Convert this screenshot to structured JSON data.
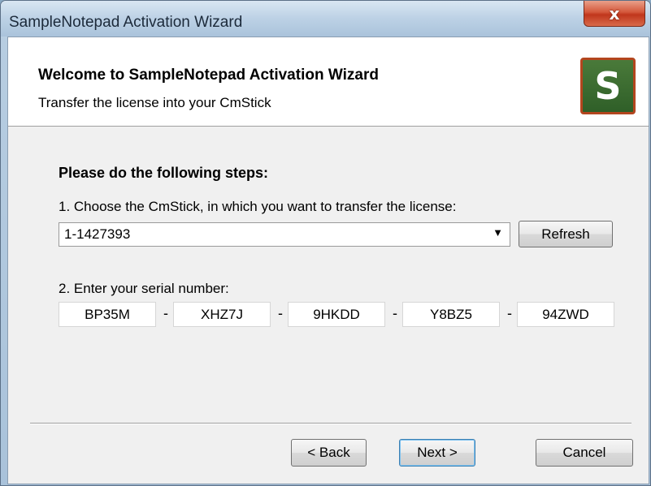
{
  "window": {
    "title": "SampleNotepad Activation Wizard",
    "close_label": "x"
  },
  "header": {
    "title": "Welcome to SampleNotepad Activation Wizard",
    "subtitle": "Transfer the license into your CmStick",
    "logo_letter": "S"
  },
  "steps": {
    "heading": "Please do the following steps:",
    "step1_label": "1. Choose the CmStick, in which you want to transfer the license:",
    "cmstick_selected": "1-1427393",
    "refresh_label": "Refresh",
    "step2_label": "2. Enter your serial number:",
    "serial_parts": [
      "BP35M",
      "XHZ7J",
      "9HKDD",
      "Y8BZ5",
      "94ZWD"
    ],
    "separator_char": "-"
  },
  "footer": {
    "back_label": "< Back",
    "next_label": "Next >",
    "cancel_label": "Cancel"
  },
  "colors": {
    "titlebar": "#bcd1e5",
    "close": "#c0361c",
    "client_bg": "#f0f0f0",
    "logo_bg": "#2f5f28",
    "logo_border": "#b3461e",
    "default_button_border": "#3c7fb1"
  },
  "icons": {
    "close": "close-icon",
    "dropdown": "chevron-down-icon"
  }
}
